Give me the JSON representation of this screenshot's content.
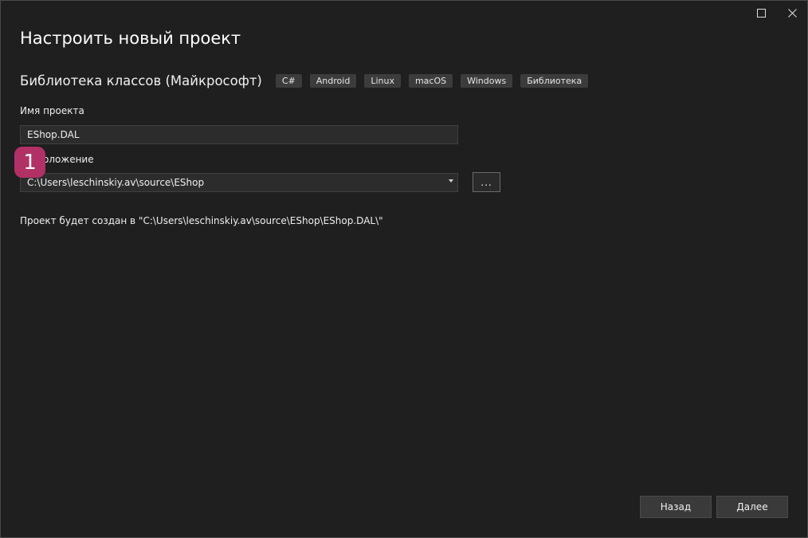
{
  "window": {
    "title": "Настроить новый проект"
  },
  "template": {
    "name": "Библиотека классов (Майкрософт)",
    "tags": [
      "C#",
      "Android",
      "Linux",
      "macOS",
      "Windows",
      "Библиотека"
    ]
  },
  "form": {
    "project_name_label": "Имя проекта",
    "project_name_value": "EShop.DAL",
    "location_label": "Расположение",
    "location_value": "C:\\Users\\leschinskiy.av\\source\\EShop",
    "browse_label": "..."
  },
  "badge": {
    "number": "1",
    "color": "#b13166"
  },
  "info": {
    "creation_path_text": "Проект будет создан в \"C:\\Users\\leschinskiy.av\\source\\EShop\\EShop.DAL\\\""
  },
  "footer": {
    "back_label": "Назад",
    "next_label": "Далее"
  },
  "icons": {
    "maximize": "maximize-icon",
    "close": "close-icon",
    "dropdown": "chevron-down-icon"
  }
}
